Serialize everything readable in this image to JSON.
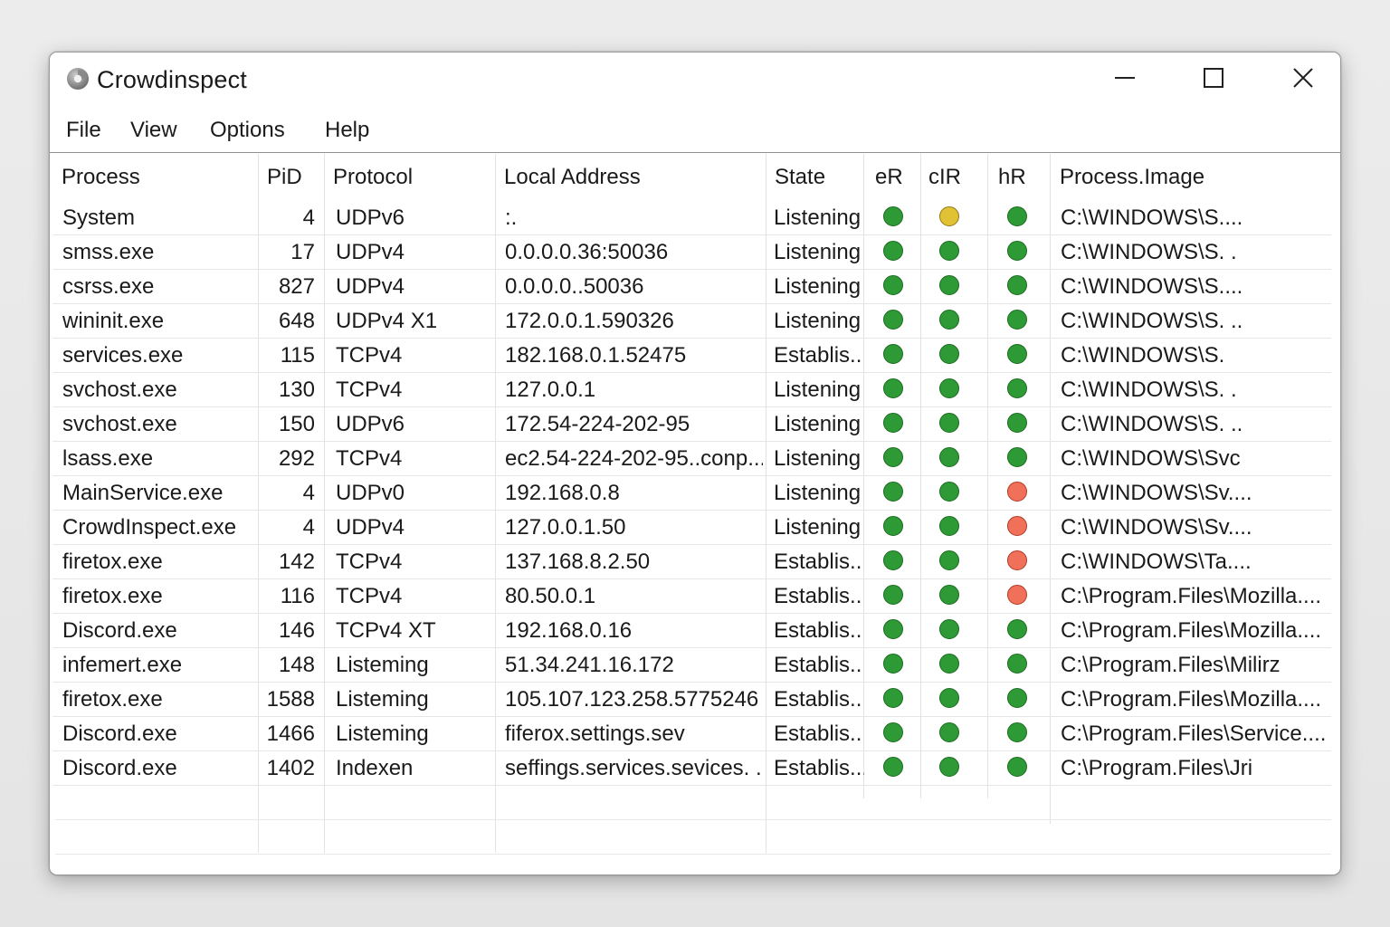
{
  "window": {
    "title": "Crowdinspect",
    "icon": "crowdinspect-app-icon",
    "controls": {
      "minimize_icon": "minimize-icon",
      "maximize_icon": "maximize-icon",
      "close_icon": "close-icon"
    }
  },
  "menu": {
    "items": [
      "File",
      "View",
      "Options",
      "Help"
    ]
  },
  "table": {
    "columns": [
      "Process",
      "PiD",
      "Protocol",
      "Local Address",
      "State",
      "eR",
      "cIR",
      "hR",
      "Process.Image"
    ],
    "status_colors": {
      "green": "#2e9a35",
      "yellow": "#e1c234",
      "red": "#f0705a"
    },
    "rows": [
      {
        "process": "System",
        "pid": "4",
        "protocol": "UDPv6",
        "address": ":.",
        "state": "Listening",
        "er": "green",
        "cir": "yellow",
        "hr": "green",
        "image": "C:\\WINDOWS\\S...."
      },
      {
        "process": "smss.exe",
        "pid": "17",
        "protocol": "UDPv4",
        "address": "0.0.0.0.36:50036",
        "state": "Listening",
        "er": "green",
        "cir": "green",
        "hr": "green",
        "image": "C:\\WINDOWS\\S. ."
      },
      {
        "process": "csrss.exe",
        "pid": "827",
        "protocol": "UDPv4",
        "address": "0.0.0.0..50036",
        "state": "Listening",
        "er": "green",
        "cir": "green",
        "hr": "green",
        "image": "C:\\WINDOWS\\S...."
      },
      {
        "process": "wininit.exe",
        "pid": "648",
        "protocol": "UDPv4 X1",
        "address": "172.0.0.1.590326",
        "state": "Listening",
        "er": "green",
        "cir": "green",
        "hr": "green",
        "image": "C:\\WINDOWS\\S. .."
      },
      {
        "process": "services.exe",
        "pid": "115",
        "protocol": "TCPv4",
        "address": "182.168.0.1.52475",
        "state": "Establis..",
        "er": "green",
        "cir": "green",
        "hr": "green",
        "image": "C:\\WINDOWS\\S."
      },
      {
        "process": "svchost.exe",
        "pid": "130",
        "protocol": "TCPv4",
        "address": "127.0.0.1",
        "state": "Listening",
        "er": "green",
        "cir": "green",
        "hr": "green",
        "image": "C:\\WINDOWS\\S. ."
      },
      {
        "process": "svchost.exe",
        "pid": "150",
        "protocol": "UDPv6",
        "address": "172.54-224-202-95",
        "state": "Listening",
        "er": "green",
        "cir": "green",
        "hr": "green",
        "image": "C:\\WINDOWS\\S. .."
      },
      {
        "process": "lsass.exe",
        "pid": "292",
        "protocol": "TCPv4",
        "address": "ec2.54-224-202-95..conp...",
        "state": "Listening",
        "er": "green",
        "cir": "green",
        "hr": "green",
        "image": "C:\\WINDOWS\\Svc"
      },
      {
        "process": "MainService.exe",
        "pid": "4",
        "protocol": "UDPv0",
        "address": "192.168.0.8",
        "state": "Listening",
        "er": "green",
        "cir": "green",
        "hr": "red",
        "image": "C:\\WINDOWS\\Sv...."
      },
      {
        "process": "CrowdInspect.exe",
        "pid": "4",
        "protocol": "UDPv4",
        "address": "127.0.0.1.50",
        "state": "Listening",
        "er": "green",
        "cir": "green",
        "hr": "red",
        "image": "C:\\WINDOWS\\Sv...."
      },
      {
        "process": "firetox.exe",
        "pid": "142",
        "protocol": "TCPv4",
        "address": "137.168.8.2.50",
        "state": "Establis..",
        "er": "green",
        "cir": "green",
        "hr": "red",
        "image": "C:\\WINDOWS\\Ta...."
      },
      {
        "process": "firetox.exe",
        "pid": "116",
        "protocol": "TCPv4",
        "address": "80.50.0.1",
        "state": "Establis..",
        "er": "green",
        "cir": "green",
        "hr": "red",
        "image": "C:\\Program.Files\\Mozilla...."
      },
      {
        "process": "Discord.exe",
        "pid": "146",
        "protocol": "TCPv4 XT",
        "address": "192.168.0.16",
        "state": "Establis..",
        "er": "green",
        "cir": "green",
        "hr": "green",
        "image": "C:\\Program.Files\\Mozilla...."
      },
      {
        "process": "infemert.exe",
        "pid": "148",
        "protocol": "Listeming",
        "address": "51.34.241.16.172",
        "state": "Establis..",
        "er": "green",
        "cir": "green",
        "hr": "green",
        "image": "C:\\Program.Files\\Milirz"
      },
      {
        "process": "firetox.exe",
        "pid": "1588",
        "protocol": "Listeming",
        "address": "105.107.123.258.5775246",
        "state": "Establis..",
        "er": "green",
        "cir": "green",
        "hr": "green",
        "image": "C:\\Program.Files\\Mozilla...."
      },
      {
        "process": "Discord.exe",
        "pid": "1466",
        "protocol": "Listeming",
        "address": "fiferox.settings.sev",
        "state": "Establis..",
        "er": "green",
        "cir": "green",
        "hr": "green",
        "image": "C:\\Program.Files\\Service...."
      },
      {
        "process": "Discord.exe",
        "pid": "1402",
        "protocol": "Indexen",
        "address": "seffings.services.sevices. . .",
        "state": "Establis...",
        "er": "green",
        "cir": "green",
        "hr": "green",
        "image": "C:\\Program.Files\\Jri"
      }
    ]
  }
}
